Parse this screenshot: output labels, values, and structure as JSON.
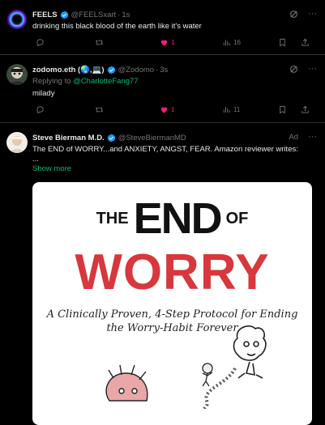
{
  "tweets": [
    {
      "name": "FEELS",
      "handle": "@FEELSxart",
      "time": "1s",
      "text": "drinking this black blood of the earth like it's water",
      "likes": "1",
      "views": "16"
    },
    {
      "name": "zodomo.eth (🌏,💻)",
      "handle": "@Zodomo",
      "time": "3s",
      "replying_prefix": "Replying to ",
      "replying_to": "@CharlotteFang77",
      "text": "milady",
      "likes": "1",
      "views": "11"
    },
    {
      "name": "Steve Bierman M.D.",
      "handle": "@SteveBiermanMD",
      "ad_label": "Ad",
      "text": "The END of WORRY...and ANXIETY, ANGST, FEAR. Amazon reviewer writes:",
      "text2": "...",
      "show_more": "Show more"
    }
  ],
  "book": {
    "the": "THE",
    "end": "END",
    "of": "OF",
    "worry": "WORRY",
    "subtitle_line1": "A Clinically Proven, 4-Step Protocol for Ending",
    "subtitle_line2": "the Worry-Habit Forever"
  },
  "colors": {
    "verified": "#1d9bf0",
    "like_active": "#f91880",
    "link_blue": "#1d9bf0",
    "link_green": "#00ba7c",
    "book_red": "#d7373d"
  },
  "icons": [
    "verified-badge-icon",
    "grok-icon",
    "more-icon",
    "reply-icon",
    "retweet-icon",
    "like-icon",
    "views-icon",
    "bookmark-icon",
    "share-icon"
  ]
}
